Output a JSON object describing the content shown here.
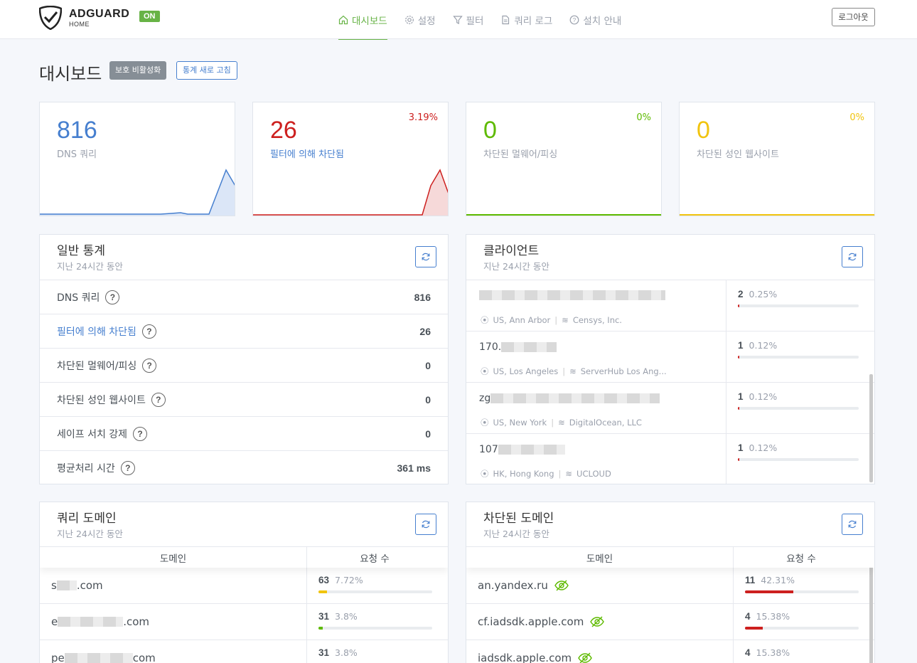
{
  "header": {
    "brand_title": "ADGUARD",
    "brand_sub": "HOME",
    "status_badge": "ON",
    "nav": [
      {
        "label": "대시보드",
        "icon": "home-icon",
        "active": true
      },
      {
        "label": "설정",
        "icon": "gear-icon",
        "active": false
      },
      {
        "label": "필터",
        "icon": "filter-icon",
        "active": false
      },
      {
        "label": "쿼리 로그",
        "icon": "document-icon",
        "active": false
      },
      {
        "label": "설치 안내",
        "icon": "help-circle-icon",
        "active": false
      }
    ],
    "logout_label": "로그아웃"
  },
  "page": {
    "title": "대시보드",
    "disable_protection_label": "보호 비활성화",
    "refresh_stats_label": "통계 새로 고침"
  },
  "stat_cards": [
    {
      "value": "816",
      "label": "DNS 쿼리",
      "percent": "",
      "color": "#467fcf"
    },
    {
      "value": "26",
      "label": "필터에 의해 차단됨",
      "percent": "3.19%",
      "color": "#cd201f"
    },
    {
      "value": "0",
      "label": "차단된 멀웨어/피싱",
      "percent": "0%",
      "color": "#5eba00"
    },
    {
      "value": "0",
      "label": "차단된 성인 웹사이트",
      "percent": "0%",
      "color": "#f1c40f"
    }
  ],
  "general_stats": {
    "title": "일반 통계",
    "subtitle": "지난 24시간 동안",
    "rows": [
      {
        "label": "DNS 쿼리",
        "value": "816"
      },
      {
        "label": "필터에 의해 차단됨",
        "value": "26"
      },
      {
        "label": "차단된 멀웨어/피싱",
        "value": "0"
      },
      {
        "label": "차단된 성인 웹사이트",
        "value": "0"
      },
      {
        "label": "세이프 서치 강제",
        "value": "0"
      },
      {
        "label": "평균처리 시간",
        "value": "361 ms"
      }
    ],
    "help_glyph": "?"
  },
  "clients": {
    "title": "클라이언트",
    "subtitle": "지난 24시간 동안",
    "rows": [
      {
        "ip_prefix": "",
        "location": "US, Ann Arbor",
        "network": "Censys, Inc.",
        "count": "2",
        "percent": "0.25%",
        "fraction": 0.0025
      },
      {
        "ip_prefix": "170.",
        "location": "US, Los Angeles",
        "network": "ServerHub Los Ang...",
        "count": "1",
        "percent": "0.12%",
        "fraction": 0.0012
      },
      {
        "ip_prefix": "zg",
        "location": "US, New York",
        "network": "DigitalOcean, LLC",
        "count": "1",
        "percent": "0.12%",
        "fraction": 0.0012
      },
      {
        "ip_prefix": "107",
        "location": "HK, Hong Kong",
        "network": "UCLOUD",
        "count": "1",
        "percent": "0.12%",
        "fraction": 0.0012
      }
    ]
  },
  "query_domains": {
    "title": "쿼리 도메인",
    "subtitle": "지난 24시간 동안",
    "col_domain": "도메인",
    "col_count": "요청 수",
    "rows": [
      {
        "prefix": "s",
        "suffix": ".com",
        "count": "63",
        "percent": "7.72%",
        "fraction": 0.0772,
        "color": "#f1c40f"
      },
      {
        "prefix": "e",
        "suffix": ".com",
        "count": "31",
        "percent": "3.8%",
        "fraction": 0.038,
        "color": "#5eba00"
      },
      {
        "prefix": "pe",
        "suffix": "com",
        "count": "31",
        "percent": "3.8%",
        "fraction": 0.038,
        "color": "#5eba00"
      }
    ]
  },
  "blocked_domains": {
    "title": "차단된 도메인",
    "subtitle": "지난 24시간 동안",
    "col_domain": "도메인",
    "col_count": "요청 수",
    "rows": [
      {
        "domain": "an.yandex.ru",
        "count": "11",
        "percent": "42.31%",
        "fraction": 0.4231,
        "color": "#cd201f"
      },
      {
        "domain": "cf.iadsdk.apple.com",
        "count": "4",
        "percent": "15.38%",
        "fraction": 0.1538,
        "color": "#cd201f"
      },
      {
        "domain": "iadsdk.apple.com",
        "count": "4",
        "percent": "15.38%",
        "fraction": 0.1538,
        "color": "#cd201f"
      }
    ]
  }
}
